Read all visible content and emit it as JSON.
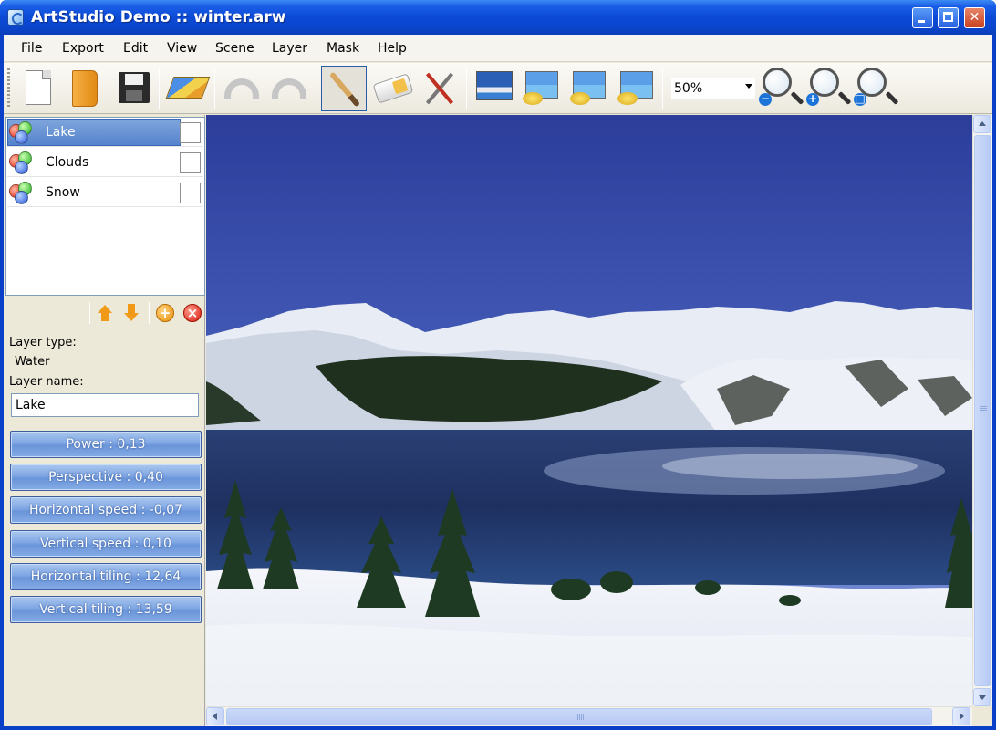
{
  "window": {
    "title": "ArtStudio Demo :: winter.arw"
  },
  "menu": [
    "File",
    "Export",
    "Edit",
    "View",
    "Scene",
    "Layer",
    "Mask",
    "Help"
  ],
  "toolbar": {
    "icons": [
      "new-file-icon",
      "open-file-icon",
      "save-icon",
      "layers-icon",
      "undo-icon",
      "redo-icon",
      "brush-icon",
      "eraser-icon",
      "tools-icon",
      "picture-icon",
      "picture-edit-icon",
      "picture-paint-icon",
      "picture-fill-icon",
      "zoom-out-icon",
      "zoom-in-icon",
      "zoom-reset-icon"
    ],
    "zoom_value": "50%",
    "zoom_in_sign": "+",
    "zoom_out_sign": "−",
    "zoom_reset_sign": "□"
  },
  "layers": {
    "items": [
      {
        "name": "Lake",
        "selected": true
      },
      {
        "name": "Clouds",
        "selected": false
      },
      {
        "name": "Snow",
        "selected": false
      }
    ],
    "add_sign": "+",
    "delete_sign": "×"
  },
  "properties": {
    "layer_type_label": "Layer type:",
    "layer_type_value": "Water",
    "layer_name_label": "Layer name:",
    "layer_name_value": "Lake",
    "params": [
      "Power : 0,13",
      "Perspective : 0,40",
      "Horizontal speed : -0,07",
      "Vertical speed : 0,10",
      "Horizontal tiling : 12,64",
      "Vertical tiling : 13,59"
    ]
  },
  "colors": {
    "titlebar": "#0a45cc",
    "selection": "#5482cc",
    "param_button": "#7fa6e3"
  }
}
